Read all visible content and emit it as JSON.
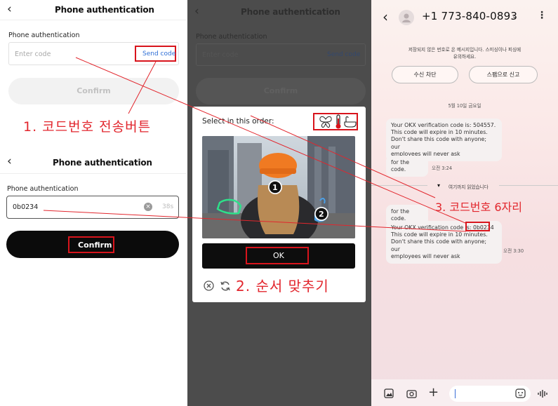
{
  "panel1": {
    "top": {
      "title": "Phone authentication",
      "field_label": "Phone authentication",
      "placeholder": "Enter code",
      "send_code": "Send code",
      "confirm": "Confirm",
      "annotation": "1. 코드번호 전송버튼"
    },
    "bottom": {
      "title": "Phone authentication",
      "field_label": "Phone authentication",
      "code_value": "0b0234",
      "timer": "38s",
      "confirm": "Confirm"
    }
  },
  "panel2": {
    "title": "Phone authentication",
    "field_label": "Phone authentication",
    "placeholder": "Enter code",
    "send_code": "Send code",
    "confirm": "Confirm",
    "captcha": {
      "instruction": "Select in this order:",
      "order_icons": [
        "butterfly-icon",
        "thermometer-icon",
        "bathtub-icon"
      ],
      "markers": [
        "1",
        "2"
      ],
      "ok": "OK",
      "annotation": "2. 순서 맞추기"
    }
  },
  "panel3": {
    "phone_number": "+1 773-840-0893",
    "warning": "저장되지 않은 번호로 온 메시지입니다. 스미싱이나 피싱에\n유의하세요.",
    "block_button": "수신 차단",
    "report_button": "스팸으로 신고",
    "date": "5월 10일 금요일",
    "messages": {
      "m1_lines": [
        "Your OKX verification code is: 504557.",
        "This code will expire in 10 minutes.",
        "Don't share this code with anyone; our",
        "employees will never ask"
      ],
      "m2": "for the code.",
      "m2_time": "오전 3:24",
      "divider": "여기까지 읽었습니다",
      "m3": "for the code.",
      "m4_prefix": "Your OKX verification code is: ",
      "m4_code": "0b0234",
      "m4_lines": [
        "This code will expire in 10 minutes.",
        "Don't share this code with anyone; our",
        "employees will never ask"
      ],
      "m4_time": "오전 3:30"
    },
    "annotation": "3. 코드번호 6자리"
  },
  "colors": {
    "annotation_red": "#e2262d",
    "link_blue": "#2f6fd6"
  }
}
